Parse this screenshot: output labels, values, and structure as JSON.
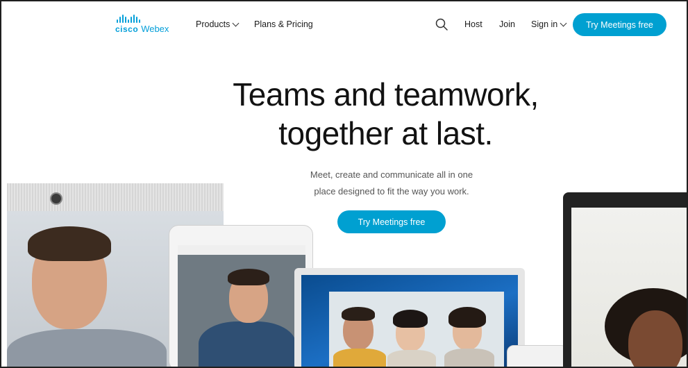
{
  "brand": {
    "cisco": "cisco",
    "product": "Webex",
    "accent": "#049fd9"
  },
  "nav": {
    "products_label": "Products",
    "plans_label": "Plans & Pricing",
    "host_label": "Host",
    "join_label": "Join",
    "signin_label": "Sign in",
    "cta_label": "Try Meetings free",
    "search_icon": "search-icon"
  },
  "hero": {
    "headline_line1": "Teams and teamwork,",
    "headline_line2": "together at last.",
    "sub_line1": "Meet, create and communicate all in one",
    "sub_line2": "place designed to fit the way you work.",
    "cta_label": "Try Meetings free",
    "cta_color": "#00a0d1"
  }
}
